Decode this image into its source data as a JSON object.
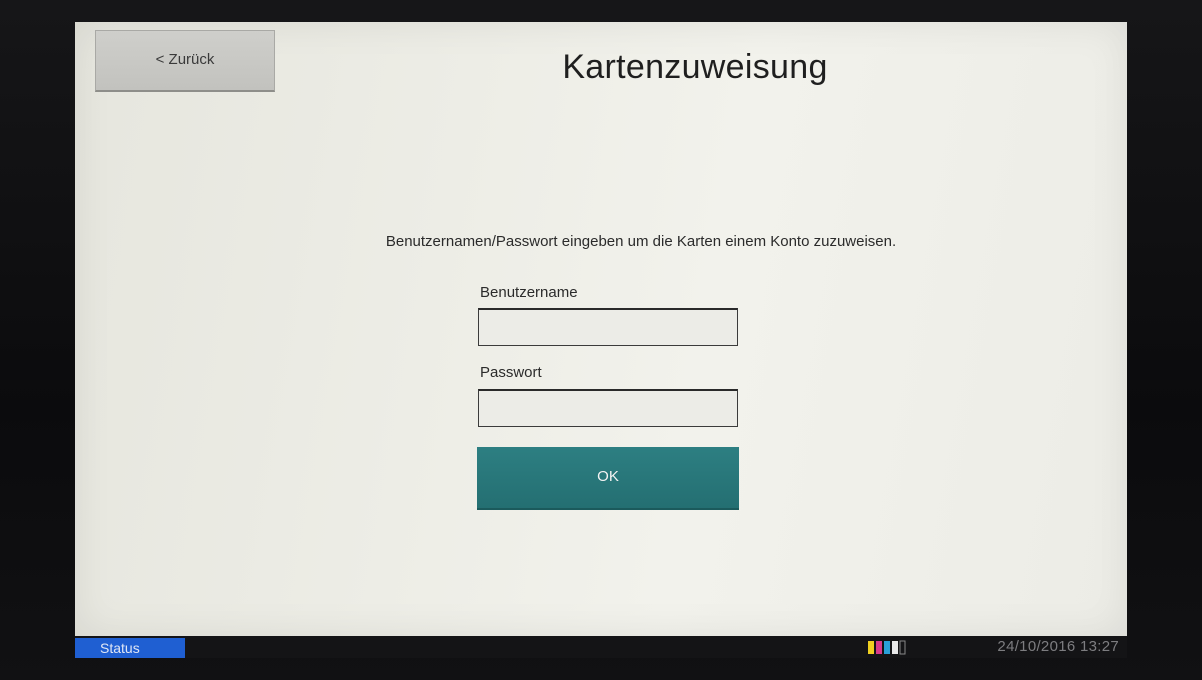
{
  "header": {
    "back_label": "< Zurück",
    "title": "Kartenzuweisung"
  },
  "form": {
    "instruction": "Benutzernamen/Passwort eingeben um die Karten einem Konto zuzuweisen.",
    "username_label": "Benutzername",
    "username_value": "",
    "password_label": "Passwort",
    "password_value": "",
    "ok_label": "OK"
  },
  "status_bar": {
    "status_label": "Status",
    "toner_icon": "toner-level-icon",
    "datetime": "24/10/2016 13:27"
  },
  "colors": {
    "accent": "#2a7a7d",
    "status_button": "#1f5fd2",
    "screen_background": "#ededE6"
  }
}
